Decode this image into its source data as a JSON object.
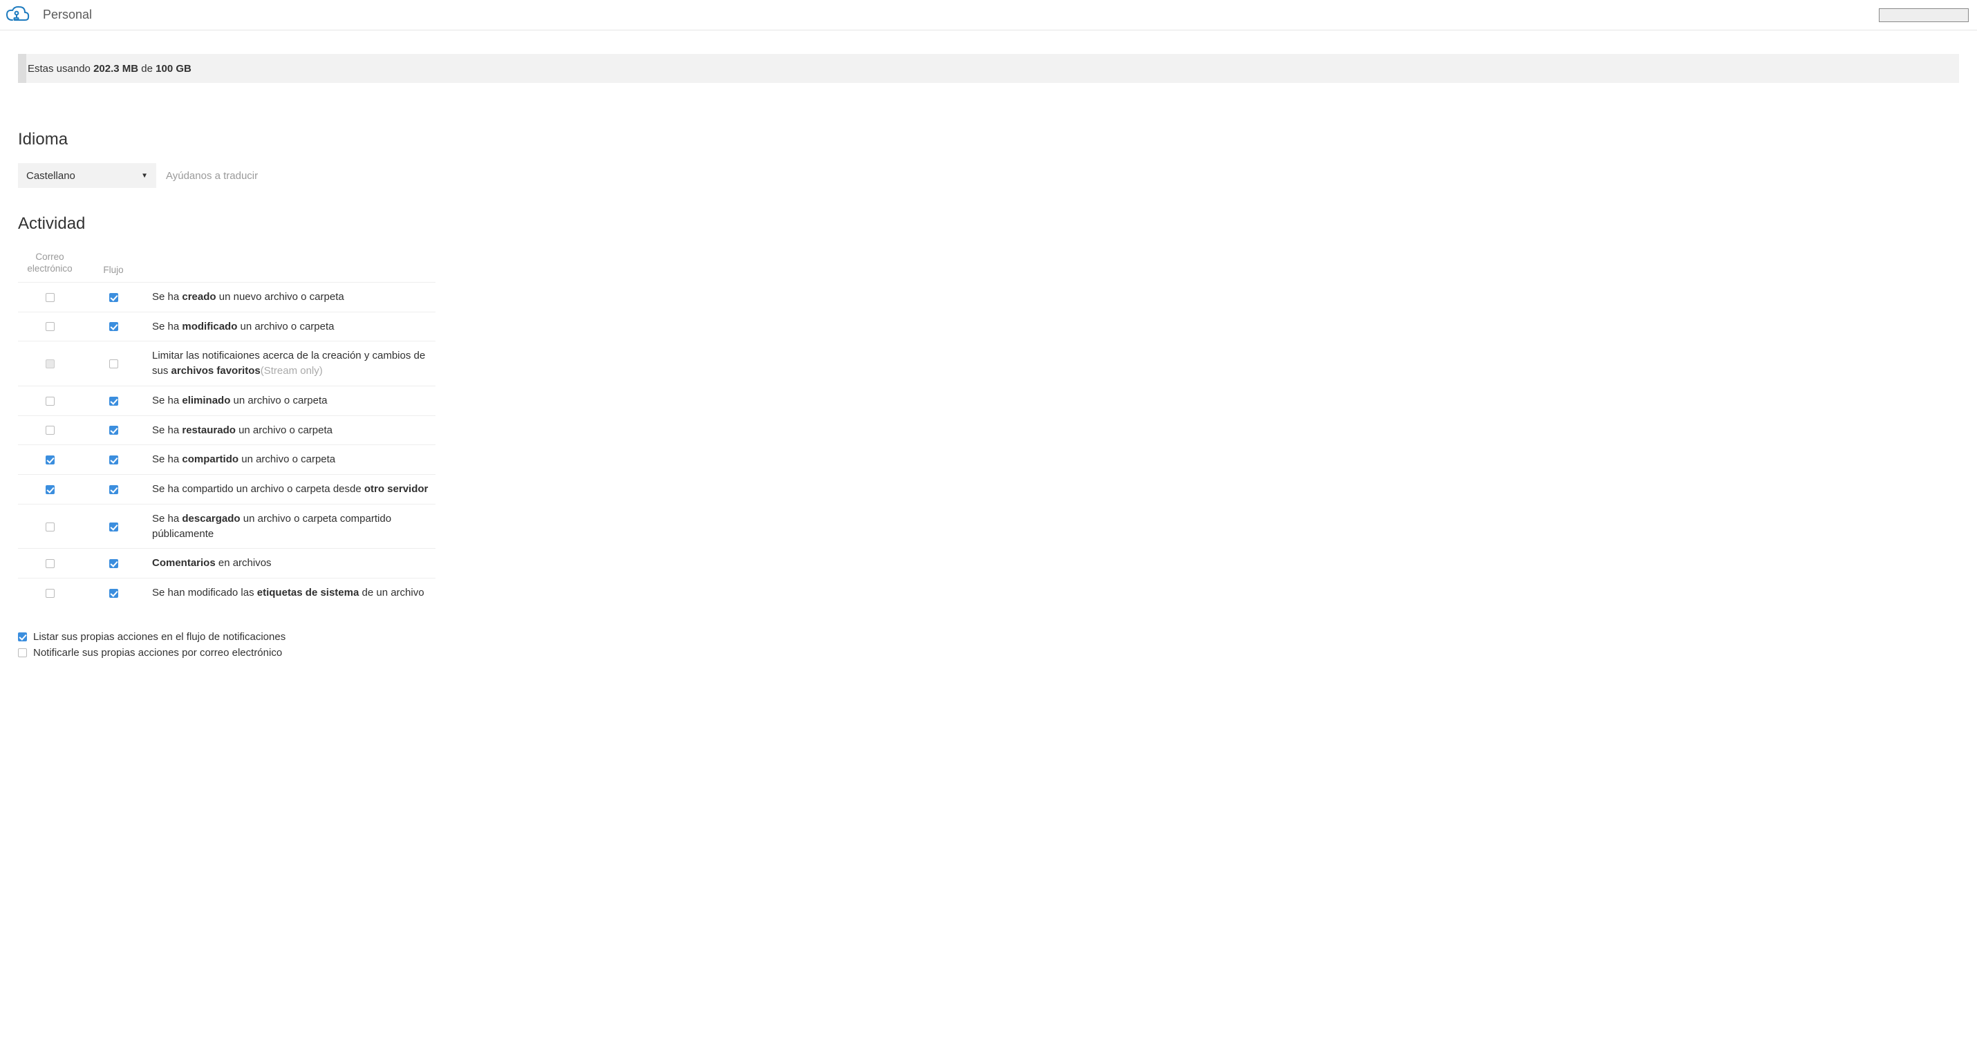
{
  "header": {
    "title": "Personal"
  },
  "quota": {
    "prefix": "Estas usando ",
    "used": "202.3 MB",
    "mid": " de ",
    "total": "100 GB"
  },
  "language": {
    "heading": "Idioma",
    "selected": "Castellano",
    "help_link": "Ayúdanos a traducir"
  },
  "activity": {
    "heading": "Actividad",
    "col_email": "Correo electrónico",
    "col_stream": "Flujo",
    "rows": [
      {
        "email": false,
        "stream": true,
        "desc_pre": "Se ha ",
        "desc_bold": "creado",
        "desc_post": " un nuevo archivo o carpeta"
      },
      {
        "email": false,
        "stream": true,
        "desc_pre": "Se ha ",
        "desc_bold": "modificado",
        "desc_post": " un archivo o carpeta"
      },
      {
        "email_disabled": true,
        "stream": false,
        "desc_pre": "Limitar las notificaiones acerca de la creación y cambios de sus ",
        "desc_bold": "archivos favoritos",
        "desc_muted": "(Stream only)"
      },
      {
        "email": false,
        "stream": true,
        "desc_pre": "Se ha ",
        "desc_bold": "eliminado",
        "desc_post": " un archivo o carpeta"
      },
      {
        "email": false,
        "stream": true,
        "desc_pre": "Se ha ",
        "desc_bold": "restaurado",
        "desc_post": " un archivo o carpeta"
      },
      {
        "email": true,
        "stream": true,
        "desc_pre": "Se ha ",
        "desc_bold": "compartido",
        "desc_post": " un archivo o carpeta"
      },
      {
        "email": true,
        "stream": true,
        "desc_pre": "Se ha compartido un archivo o carpeta desde ",
        "desc_bold": "otro servidor"
      },
      {
        "email": false,
        "stream": true,
        "desc_pre": "Se ha ",
        "desc_bold": "descargado",
        "desc_post": " un archivo o carpeta compartido públicamente"
      },
      {
        "email": false,
        "stream": true,
        "desc_bold": "Comentarios",
        "desc_post": " en archivos"
      },
      {
        "email": false,
        "stream": true,
        "desc_pre": "Se han modificado las ",
        "desc_bold": "etiquetas de sistema",
        "desc_post": " de un archivo"
      }
    ],
    "opt_list_own": {
      "checked": true,
      "label": "Listar sus propias acciones en el flujo de notificaciones"
    },
    "opt_notify_own": {
      "checked": false,
      "label": "Notificarle sus propias acciones por correo electrónico"
    }
  }
}
